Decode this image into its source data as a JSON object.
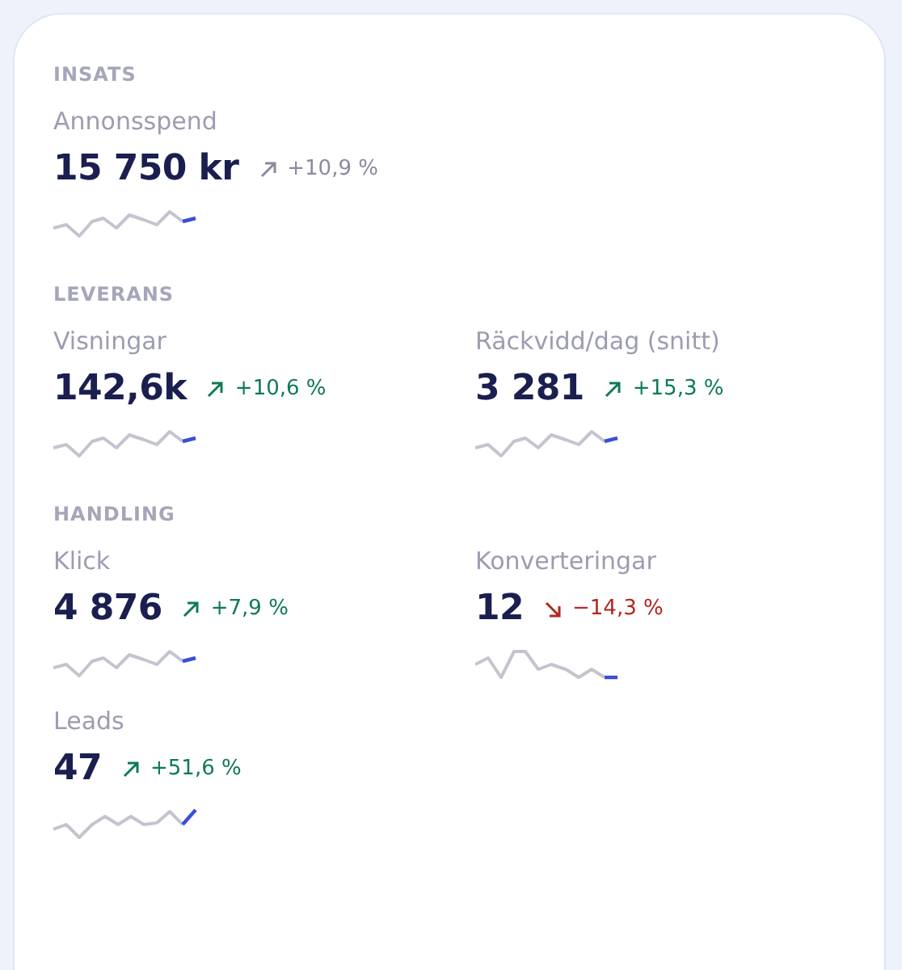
{
  "sections": [
    {
      "title": "INSATS",
      "metrics": [
        {
          "label": "Annonsspend",
          "value": "15 750 kr",
          "change": "+10,9 %",
          "rising": true,
          "kind": "neutral"
        }
      ]
    },
    {
      "title": "LEVERANS",
      "metrics": [
        {
          "label": "Visningar",
          "value": "142,6k",
          "change": "+10,6 %",
          "rising": true,
          "kind": "positive"
        },
        {
          "label": "Räckvidd/dag (snitt)",
          "value": "3 281",
          "change": "+15,3 %",
          "rising": true,
          "kind": "positive"
        }
      ]
    },
    {
      "title": "HANDLING",
      "metrics": [
        {
          "label": "Klick",
          "value": "4 876",
          "change": "+7,9 %",
          "rising": true,
          "kind": "positive"
        },
        {
          "label": "Konverteringar",
          "value": "12",
          "change": "−14,3 %",
          "rising": false,
          "kind": "negative"
        },
        {
          "label": "Leads",
          "value": "47",
          "change": "+51,6 %",
          "rising": true,
          "kind": "positive"
        }
      ]
    }
  ]
}
